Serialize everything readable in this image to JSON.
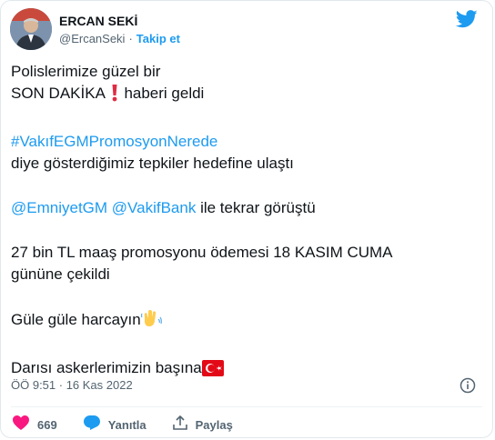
{
  "user": {
    "display_name": "ERCAN SEKİ",
    "handle": "@ErcanSeki",
    "separator": "·",
    "follow_label": "Takip et"
  },
  "tweet": {
    "line1": "Polislerimize güzel bir",
    "line2a": "SON DAKİKA",
    "line2b": " haberi geldi",
    "hashtag": "#VakıfEGMPromosyonNerede",
    "line4": "diye gösterdiğimiz tepkiler hedefine ulaştı",
    "mention1": "@EmniyetGM",
    "mention2": "@VakifBank",
    "line5_rest": " ile tekrar görüştü",
    "line6a": "27 bin TL maaş promosyonu ödemesi 18 KASIM CUMA",
    "line6b": "gününe çekildi",
    "line7": "Güle güle harcayın",
    "line8": "Darısı askerlerimizin başına"
  },
  "meta": {
    "timestamp": "ÖÖ 9:51 · 16 Kas 2022"
  },
  "actions": {
    "like_count": "669",
    "reply_label": "Yanıtla",
    "share_label": "Paylaş"
  },
  "colors": {
    "accent": "#1d9bf0",
    "like": "#f91880",
    "muted": "#536471",
    "text": "#0f1419"
  },
  "icons": [
    "twitter-bird-icon",
    "exclamation-emoji-icon",
    "waving-hands-emoji-icon",
    "turkey-flag-emoji-icon",
    "info-icon",
    "heart-icon",
    "reply-icon",
    "share-icon"
  ]
}
